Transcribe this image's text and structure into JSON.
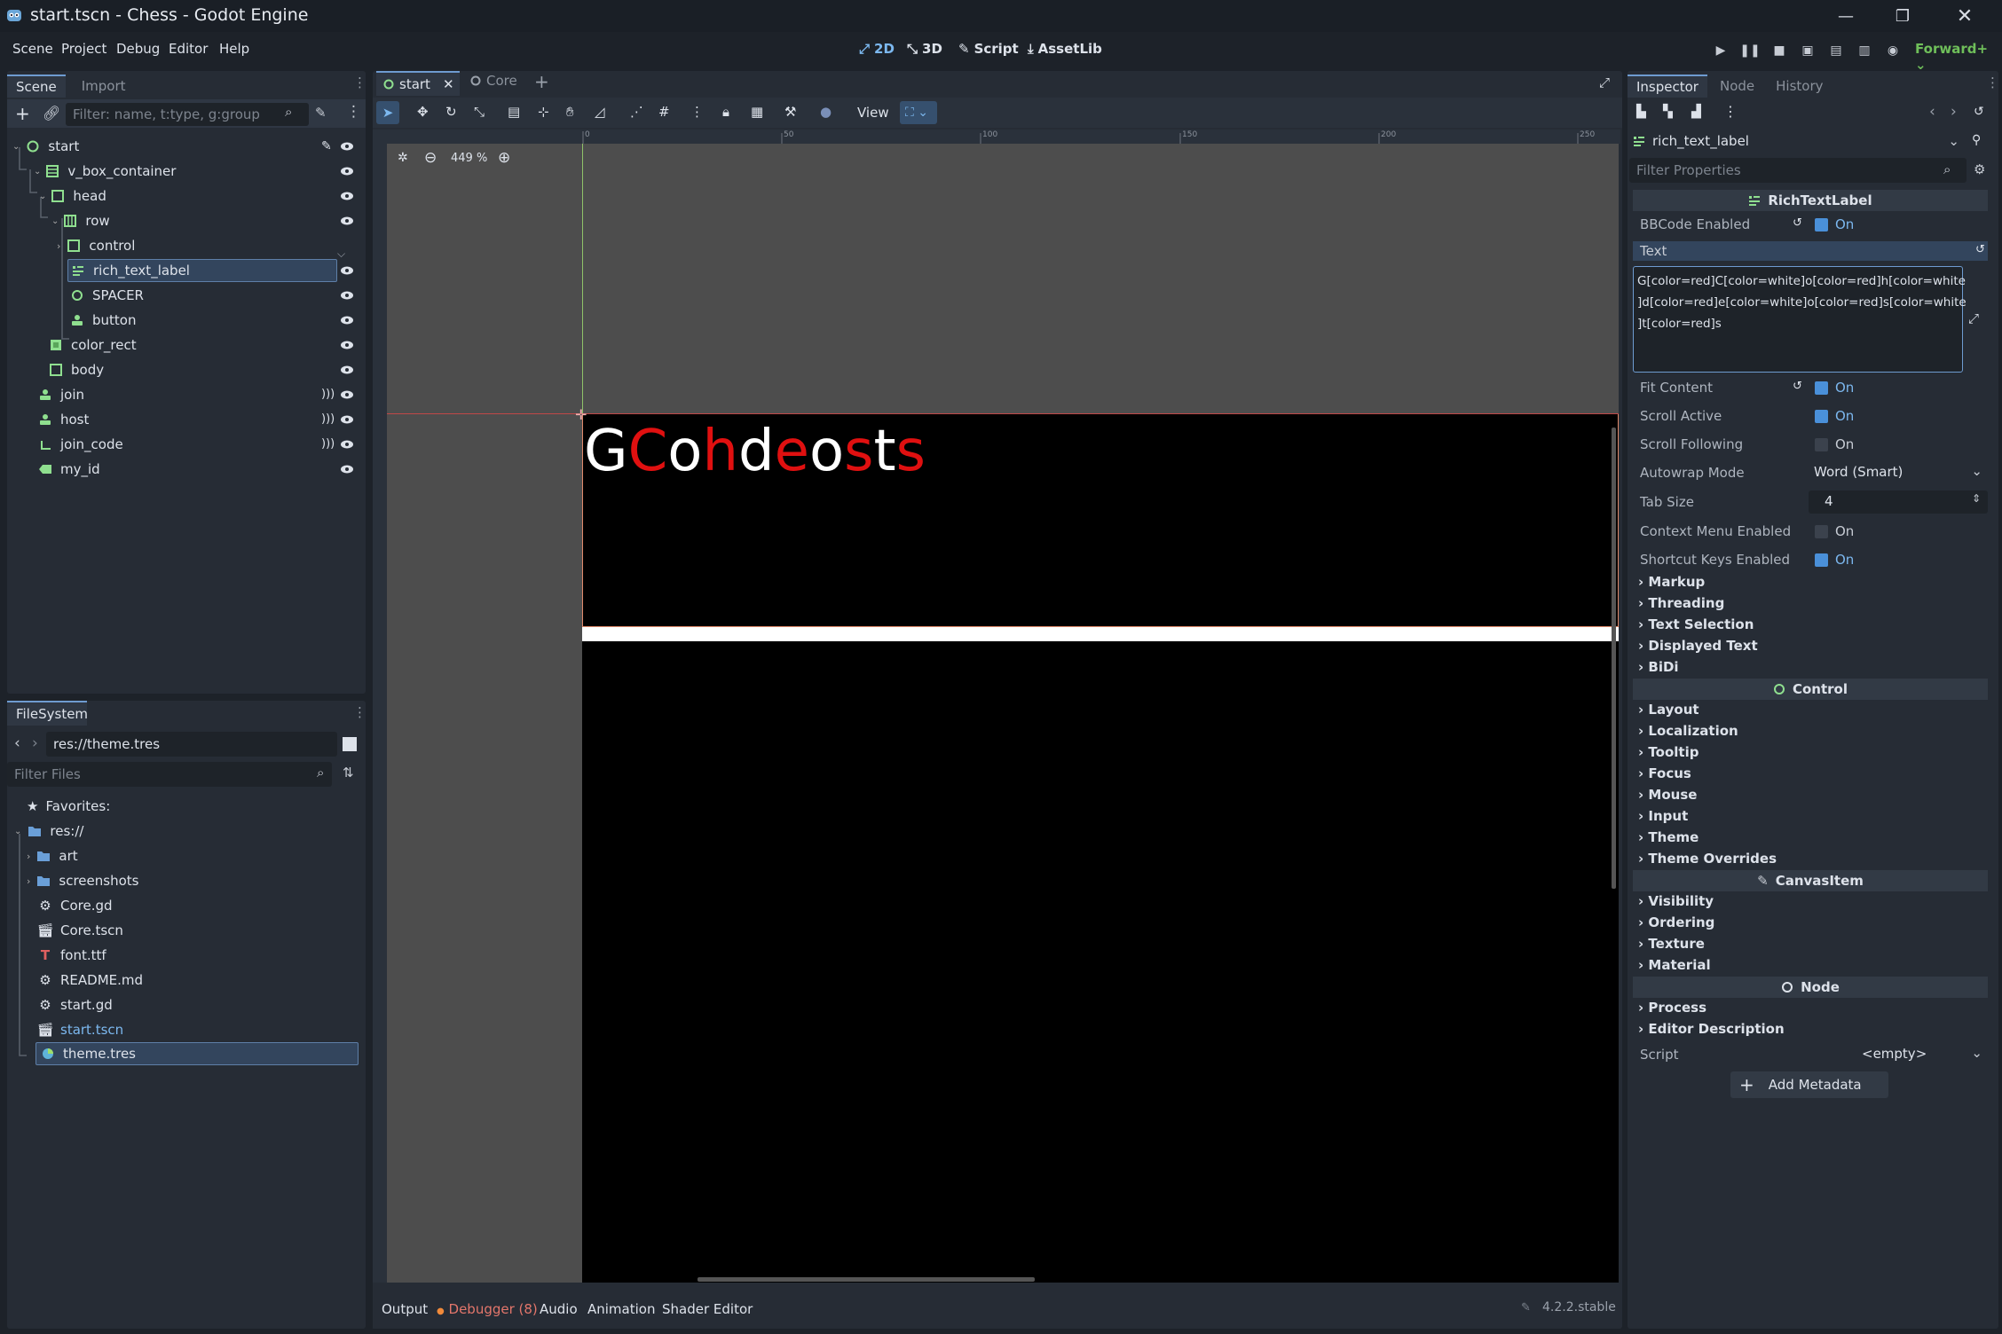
{
  "window": {
    "title": "start.tscn - Chess - Godot Engine",
    "controls": [
      "minimize-icon",
      "restore-icon",
      "close-icon"
    ]
  },
  "menubar": {
    "items": [
      "Scene",
      "Project",
      "Debug",
      "Editor",
      "Help"
    ],
    "modes": [
      "2D",
      "3D",
      "Script",
      "AssetLib"
    ],
    "renderer": "Forward+"
  },
  "scene_dock": {
    "tabs": [
      "Scene",
      "Import"
    ],
    "filter_placeholder": "Filter: name, t:type, g:group",
    "nodes": [
      {
        "name": "start",
        "icon": "node-icon"
      },
      {
        "name": "v_box_container",
        "icon": "vbox-icon"
      },
      {
        "name": "head",
        "icon": "control-icon"
      },
      {
        "name": "row",
        "icon": "hbox-icon"
      },
      {
        "name": "control",
        "icon": "control-icon"
      },
      {
        "name": "rich_text_label",
        "icon": "rich-text-icon"
      },
      {
        "name": "SPACER",
        "icon": "node-icon"
      },
      {
        "name": "button",
        "icon": "button-icon"
      },
      {
        "name": "color_rect",
        "icon": "color-rect-icon"
      },
      {
        "name": "body",
        "icon": "control-icon"
      },
      {
        "name": "join",
        "icon": "button-icon"
      },
      {
        "name": "host",
        "icon": "button-icon"
      },
      {
        "name": "join_code",
        "icon": "line-edit-icon"
      },
      {
        "name": "my_id",
        "icon": "label-icon"
      }
    ]
  },
  "filesystem": {
    "title": "FileSystem",
    "path": "res://theme.tres",
    "filter_placeholder": "Filter Files",
    "favorites_label": "Favorites:",
    "root": "res://",
    "items": [
      {
        "name": "art",
        "type": "folder"
      },
      {
        "name": "screenshots",
        "type": "folder"
      },
      {
        "name": "Core.gd",
        "type": "script"
      },
      {
        "name": "Core.tscn",
        "type": "scene"
      },
      {
        "name": "font.ttf",
        "type": "font"
      },
      {
        "name": "README.md",
        "type": "doc"
      },
      {
        "name": "start.gd",
        "type": "script"
      },
      {
        "name": "start.tscn",
        "type": "scene"
      },
      {
        "name": "theme.tres",
        "type": "theme"
      }
    ]
  },
  "viewport": {
    "tabs": [
      "start",
      "Core"
    ],
    "view_label": "View",
    "zoom": "449 %",
    "ruler_ticks": [
      "0",
      "50",
      "100",
      "150",
      "200",
      "250"
    ],
    "preview_text": [
      {
        "ch": "G",
        "color": "#ffffff"
      },
      {
        "ch": "C",
        "color": "#e01010"
      },
      {
        "ch": "o",
        "color": "#ffffff"
      },
      {
        "ch": "h",
        "color": "#e01010"
      },
      {
        "ch": "d",
        "color": "#ffffff"
      },
      {
        "ch": "e",
        "color": "#e01010"
      },
      {
        "ch": "o",
        "color": "#ffffff"
      },
      {
        "ch": "s",
        "color": "#e01010"
      },
      {
        "ch": "t",
        "color": "#ffffff"
      },
      {
        "ch": "s",
        "color": "#e01010"
      }
    ]
  },
  "bottom_panel": {
    "tabs": [
      "Output",
      "Debugger (8)",
      "Audio",
      "Animation",
      "Shader Editor"
    ],
    "version": "4.2.2.stable"
  },
  "inspector": {
    "tabs": [
      "Inspector",
      "Node",
      "History"
    ],
    "node_name": "rich_text_label",
    "filter_placeholder": "Filter Properties",
    "class_header": "RichTextLabel",
    "bbcode": {
      "label": "BBCode Enabled",
      "value": "On"
    },
    "text_label": "Text",
    "text_value_lines": [
      "G[color=red]C[color=white]o[color=red]h[color=white",
      "]d[color=red]e[color=white]o[color=red]s[color=white",
      "]t[color=red]s"
    ],
    "props": [
      {
        "label": "Fit Content",
        "value": "On",
        "checked": true,
        "revert": true
      },
      {
        "label": "Scroll Active",
        "value": "On",
        "checked": true
      },
      {
        "label": "Scroll Following",
        "value": "On",
        "checked": false
      },
      {
        "label": "Autowrap Mode",
        "value": "Word (Smart)",
        "kind": "dropdown"
      },
      {
        "label": "Tab Size",
        "value": "4",
        "kind": "spin"
      },
      {
        "label": "Context Menu Enabled",
        "value": "On",
        "checked": false
      },
      {
        "label": "Shortcut Keys Enabled",
        "value": "On",
        "checked": true
      }
    ],
    "rtl_sections": [
      "Markup",
      "Threading",
      "Text Selection",
      "Displayed Text",
      "BiDi"
    ],
    "control_header": "Control",
    "control_sections": [
      "Layout",
      "Localization",
      "Tooltip",
      "Focus",
      "Mouse",
      "Input",
      "Theme",
      "Theme Overrides"
    ],
    "canvas_header": "CanvasItem",
    "canvas_sections": [
      "Visibility",
      "Ordering",
      "Texture",
      "Material"
    ],
    "node_header": "Node",
    "node_sections": [
      "Process",
      "Editor Description"
    ],
    "script_label": "Script",
    "script_value": "<empty>",
    "add_metadata": "Add Metadata"
  }
}
